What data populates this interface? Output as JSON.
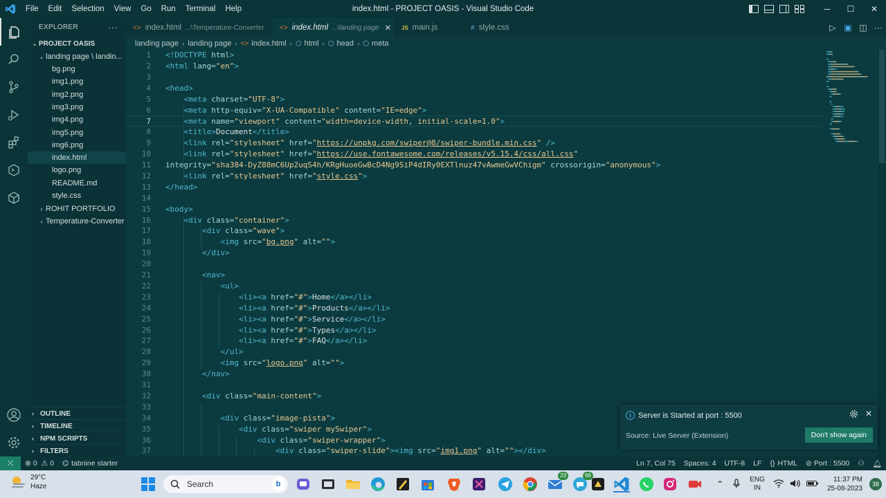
{
  "titlebar": {
    "menus": [
      "File",
      "Edit",
      "Selection",
      "View",
      "Go",
      "Run",
      "Terminal",
      "Help"
    ],
    "window_title": "index.html - PROJECT OASIS - Visual Studio Code",
    "minimize": "─",
    "maximize": "☐",
    "close": "✕"
  },
  "sidebar": {
    "header": "EXPLORER",
    "more": "···",
    "project": "PROJECT OASIS",
    "folder": "landing page \\ landin...",
    "files": [
      "bg.png",
      "img1.png",
      "img2.png",
      "img3.png",
      "img4.png",
      "img5.png",
      "img6.png",
      "index.html",
      "logo.png",
      "README.md",
      "style.css"
    ],
    "selected_file": "index.html",
    "folders_collapsed": [
      "ROHIT PORTFOLIO",
      "Temperature-Converter"
    ],
    "sections": [
      "OUTLINE",
      "TIMELINE",
      "NPM SCRIPTS",
      "FILTERS"
    ]
  },
  "tabs": [
    {
      "icon": "<>",
      "label": "index.html",
      "desc": "...\\Temperature-Converter",
      "active": false
    },
    {
      "icon": "<>",
      "label": "index.html",
      "desc": "...\\landing page",
      "active": true,
      "close": "✕"
    },
    {
      "icon": "JS",
      "label": "main.js",
      "desc": "",
      "active": false
    },
    {
      "icon": "#",
      "label": "style.css",
      "desc": "",
      "active": false
    }
  ],
  "breadcrumb": [
    "landing page",
    "landing page",
    "index.html",
    "html",
    "head",
    "meta"
  ],
  "editor": {
    "current_line": 7,
    "lines": [
      {
        "n": "1",
        "tokens": [
          [
            "t",
            "<!DOCTYPE "
          ],
          [
            "a",
            "html"
          ],
          [
            "t",
            ">"
          ]
        ]
      },
      {
        "n": "2",
        "tokens": [
          [
            "t",
            "<html "
          ],
          [
            "a",
            "lang="
          ],
          [
            "s",
            "\"en\""
          ],
          [
            "t",
            ">"
          ]
        ]
      },
      {
        "n": "3",
        "tokens": []
      },
      {
        "n": "4",
        "tokens": [
          [
            "t",
            "<head>"
          ]
        ]
      },
      {
        "n": "5",
        "tokens": [
          [
            "x",
            "    "
          ],
          [
            "t",
            "<meta "
          ],
          [
            "a",
            "charset="
          ],
          [
            "s",
            "\"UTF-8\""
          ],
          [
            "t",
            ">"
          ]
        ]
      },
      {
        "n": "6",
        "tokens": [
          [
            "x",
            "    "
          ],
          [
            "t",
            "<meta "
          ],
          [
            "a",
            "http-equiv="
          ],
          [
            "s",
            "\"X-UA-Compatible\""
          ],
          [
            "a",
            " content="
          ],
          [
            "s",
            "\"IE=edge\""
          ],
          [
            "t",
            ">"
          ]
        ]
      },
      {
        "n": "7",
        "tokens": [
          [
            "x",
            "    "
          ],
          [
            "t",
            "<meta "
          ],
          [
            "a",
            "name="
          ],
          [
            "s",
            "\"viewport\""
          ],
          [
            "a",
            " content="
          ],
          [
            "s",
            "\"width=device-width, initial-scale=1.0\""
          ],
          [
            "t",
            ">"
          ]
        ]
      },
      {
        "n": "8",
        "tokens": [
          [
            "x",
            "    "
          ],
          [
            "t",
            "<title>"
          ],
          [
            "x",
            "Document"
          ],
          [
            "t",
            "</title>"
          ]
        ]
      },
      {
        "n": "9",
        "tokens": [
          [
            "x",
            "    "
          ],
          [
            "t",
            "<link "
          ],
          [
            "a",
            "rel="
          ],
          [
            "s",
            "\"stylesheet\""
          ],
          [
            "a",
            " href="
          ],
          [
            "s",
            "\""
          ],
          [
            "u",
            "https://unpkg.com/swiper@8/swiper-bundle.min.css"
          ],
          [
            "s",
            "\""
          ],
          [
            "t",
            " />"
          ]
        ]
      },
      {
        "n": "10",
        "tokens": [
          [
            "x",
            "    "
          ],
          [
            "t",
            "<link "
          ],
          [
            "a",
            "rel="
          ],
          [
            "s",
            "\"stylesheet\""
          ],
          [
            "a",
            " href="
          ],
          [
            "s",
            "\""
          ],
          [
            "u",
            "https://use.fontawesome.com/releases/v5.15.4/css/all.css"
          ],
          [
            "s",
            "\""
          ]
        ]
      },
      {
        "n": "11",
        "tokens": [
          [
            "a",
            "integrity="
          ],
          [
            "s",
            "\"sha384-DyZ88mC6Up2uqS4h/KRgHuoeGwBcD4Ng9SiP4dIRy0EXTlnuz47vAwmeGwVChigm\""
          ],
          [
            "a",
            " crossorigin="
          ],
          [
            "s",
            "\"anonymous\""
          ],
          [
            "t",
            ">"
          ]
        ]
      },
      {
        "n": "12",
        "tokens": [
          [
            "x",
            "    "
          ],
          [
            "t",
            "<link "
          ],
          [
            "a",
            "rel="
          ],
          [
            "s",
            "\"stylesheet\""
          ],
          [
            "a",
            " href="
          ],
          [
            "s",
            "\""
          ],
          [
            "u",
            "style.css"
          ],
          [
            "s",
            "\""
          ],
          [
            "t",
            ">"
          ]
        ]
      },
      {
        "n": "13",
        "tokens": [
          [
            "t",
            "</head>"
          ]
        ]
      },
      {
        "n": "14",
        "tokens": []
      },
      {
        "n": "15",
        "tokens": [
          [
            "t",
            "<body>"
          ]
        ]
      },
      {
        "n": "16",
        "tokens": [
          [
            "x",
            "    "
          ],
          [
            "t",
            "<div "
          ],
          [
            "a",
            "class="
          ],
          [
            "s",
            "\"container\""
          ],
          [
            "t",
            ">"
          ]
        ]
      },
      {
        "n": "17",
        "tokens": [
          [
            "x",
            "        "
          ],
          [
            "t",
            "<div "
          ],
          [
            "a",
            "class="
          ],
          [
            "s",
            "\"wave\""
          ],
          [
            "t",
            ">"
          ]
        ]
      },
      {
        "n": "18",
        "tokens": [
          [
            "x",
            "            "
          ],
          [
            "t",
            "<img "
          ],
          [
            "a",
            "src="
          ],
          [
            "s",
            "\""
          ],
          [
            "u",
            "bg.png"
          ],
          [
            "s",
            "\""
          ],
          [
            "a",
            " alt="
          ],
          [
            "s",
            "\"\""
          ],
          [
            "t",
            ">"
          ]
        ]
      },
      {
        "n": "19",
        "tokens": [
          [
            "x",
            "        "
          ],
          [
            "t",
            "</div>"
          ]
        ]
      },
      {
        "n": "20",
        "tokens": []
      },
      {
        "n": "21",
        "tokens": [
          [
            "x",
            "        "
          ],
          [
            "t",
            "<nav>"
          ]
        ]
      },
      {
        "n": "22",
        "tokens": [
          [
            "x",
            "            "
          ],
          [
            "t",
            "<ul>"
          ]
        ]
      },
      {
        "n": "23",
        "tokens": [
          [
            "x",
            "                "
          ],
          [
            "t",
            "<li><a "
          ],
          [
            "a",
            "href="
          ],
          [
            "s",
            "\"#\""
          ],
          [
            "t",
            ">"
          ],
          [
            "x",
            "Home"
          ],
          [
            "t",
            "</a></li>"
          ]
        ]
      },
      {
        "n": "24",
        "tokens": [
          [
            "x",
            "                "
          ],
          [
            "t",
            "<li><a "
          ],
          [
            "a",
            "href="
          ],
          [
            "s",
            "\"#\""
          ],
          [
            "t",
            ">"
          ],
          [
            "x",
            "Products"
          ],
          [
            "t",
            "</a></li>"
          ]
        ]
      },
      {
        "n": "25",
        "tokens": [
          [
            "x",
            "                "
          ],
          [
            "t",
            "<li><a "
          ],
          [
            "a",
            "href="
          ],
          [
            "s",
            "\"#\""
          ],
          [
            "t",
            ">"
          ],
          [
            "x",
            "Service"
          ],
          [
            "t",
            "</a></li>"
          ]
        ]
      },
      {
        "n": "26",
        "tokens": [
          [
            "x",
            "                "
          ],
          [
            "t",
            "<li><a "
          ],
          [
            "a",
            "href="
          ],
          [
            "s",
            "\"#\""
          ],
          [
            "t",
            ">"
          ],
          [
            "x",
            "Types"
          ],
          [
            "t",
            "</a></li>"
          ]
        ]
      },
      {
        "n": "27",
        "tokens": [
          [
            "x",
            "                "
          ],
          [
            "t",
            "<li><a "
          ],
          [
            "a",
            "href="
          ],
          [
            "s",
            "\"#\""
          ],
          [
            "t",
            ">"
          ],
          [
            "x",
            "FAQ"
          ],
          [
            "t",
            "</a></li>"
          ]
        ]
      },
      {
        "n": "28",
        "tokens": [
          [
            "x",
            "            "
          ],
          [
            "t",
            "</ul>"
          ]
        ]
      },
      {
        "n": "29",
        "tokens": [
          [
            "x",
            "            "
          ],
          [
            "t",
            "<img "
          ],
          [
            "a",
            "src="
          ],
          [
            "s",
            "\""
          ],
          [
            "u",
            "logo.png"
          ],
          [
            "s",
            "\""
          ],
          [
            "a",
            " alt="
          ],
          [
            "s",
            "\"\""
          ],
          [
            "t",
            ">"
          ]
        ]
      },
      {
        "n": "30",
        "tokens": [
          [
            "x",
            "        "
          ],
          [
            "t",
            "</nav>"
          ]
        ]
      },
      {
        "n": "31",
        "tokens": []
      },
      {
        "n": "32",
        "tokens": [
          [
            "x",
            "        "
          ],
          [
            "t",
            "<div "
          ],
          [
            "a",
            "class="
          ],
          [
            "s",
            "\"main-content\""
          ],
          [
            "t",
            ">"
          ]
        ]
      },
      {
        "n": "33",
        "tokens": []
      },
      {
        "n": "34",
        "tokens": [
          [
            "x",
            "            "
          ],
          [
            "t",
            "<div "
          ],
          [
            "a",
            "class="
          ],
          [
            "s",
            "\"image-pista\""
          ],
          [
            "t",
            ">"
          ]
        ]
      },
      {
        "n": "35",
        "tokens": [
          [
            "x",
            "                "
          ],
          [
            "t",
            "<div "
          ],
          [
            "a",
            "class="
          ],
          [
            "s",
            "\"swiper mySwiper\""
          ],
          [
            "t",
            ">"
          ]
        ]
      },
      {
        "n": "36",
        "tokens": [
          [
            "x",
            "                    "
          ],
          [
            "t",
            "<div "
          ],
          [
            "a",
            "class="
          ],
          [
            "s",
            "\"swiper-wrapper\""
          ],
          [
            "t",
            ">"
          ]
        ]
      },
      {
        "n": "37",
        "tokens": [
          [
            "x",
            "                        "
          ],
          [
            "t",
            "<div "
          ],
          [
            "a",
            "class="
          ],
          [
            "s",
            "\"swiper-slide\""
          ],
          [
            "t",
            "><img "
          ],
          [
            "a",
            "src="
          ],
          [
            "s",
            "\""
          ],
          [
            "u",
            "img1.png"
          ],
          [
            "s",
            "\""
          ],
          [
            "a",
            " alt="
          ],
          [
            "s",
            "\"\""
          ],
          [
            "t",
            "></div>"
          ]
        ]
      }
    ]
  },
  "notification": {
    "message": "Server is Started at port : 5500",
    "source": "Source: Live Server (Extension)",
    "button": "Don't show again",
    "close": "✕"
  },
  "statusbar": {
    "remote": "⤫",
    "errors": "0",
    "warnings": "0",
    "tabnine": "tabnine starter",
    "position": "Ln 7, Col 75",
    "spaces": "Spaces: 4",
    "encoding": "UTF-8",
    "eol": "LF",
    "language": "HTML",
    "port": "Port : 5500"
  },
  "taskbar": {
    "temperature": "29°C",
    "condition": "Haze",
    "search": "Search",
    "badge_a": "23",
    "badge_b": "66",
    "lang_line1": "ENG",
    "lang_line2": "IN",
    "time": "11:37 PM",
    "date": "25-08-2023",
    "notifications": "38"
  },
  "colors": {
    "editor_bg": "#0c3b3f",
    "sidebar_bg": "#0b3236",
    "tag": "#4fb8d0",
    "string": "#e7c790",
    "accent_button": "#1f7a68"
  }
}
